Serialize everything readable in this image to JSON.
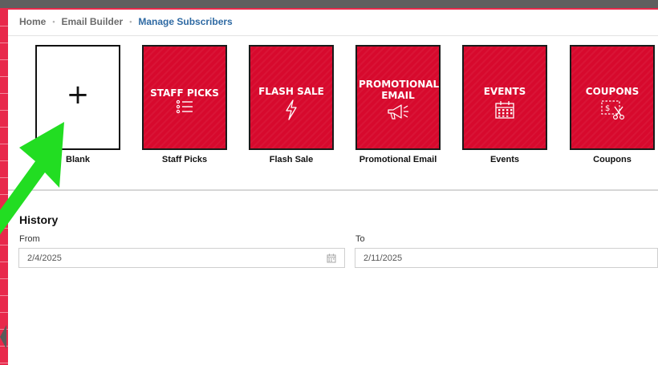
{
  "breadcrumb": {
    "home": "Home",
    "email_builder": "Email Builder",
    "current": "Manage Subscribers",
    "separator": "•"
  },
  "templates": [
    {
      "id": "blank",
      "label": "Blank",
      "tile_title": "",
      "icon": "plus-icon"
    },
    {
      "id": "staff-picks",
      "label": "Staff Picks",
      "tile_title": "STAFF PICKS",
      "icon": "checklist-icon"
    },
    {
      "id": "flash-sale",
      "label": "Flash Sale",
      "tile_title": "FLASH SALE",
      "icon": "lightning-icon"
    },
    {
      "id": "promotional-email",
      "label": "Promotional Email",
      "tile_title_line1": "PROMOTIONAL",
      "tile_title_line2": "EMAIL",
      "icon": "megaphone-icon"
    },
    {
      "id": "events",
      "label": "Events",
      "tile_title": "EVENTS",
      "icon": "calendar-icon"
    },
    {
      "id": "coupons",
      "label": "Coupons",
      "tile_title": "COUPONS",
      "icon": "scissors-coupon-icon"
    }
  ],
  "history": {
    "title": "History",
    "from_label": "From",
    "to_label": "To",
    "from_value": "2/4/2025",
    "to_value": "2/11/2025"
  },
  "colors": {
    "tile_red": "#d7092d",
    "breadcrumb_active": "#2f6aa3",
    "arrow_green": "#22dd22"
  }
}
